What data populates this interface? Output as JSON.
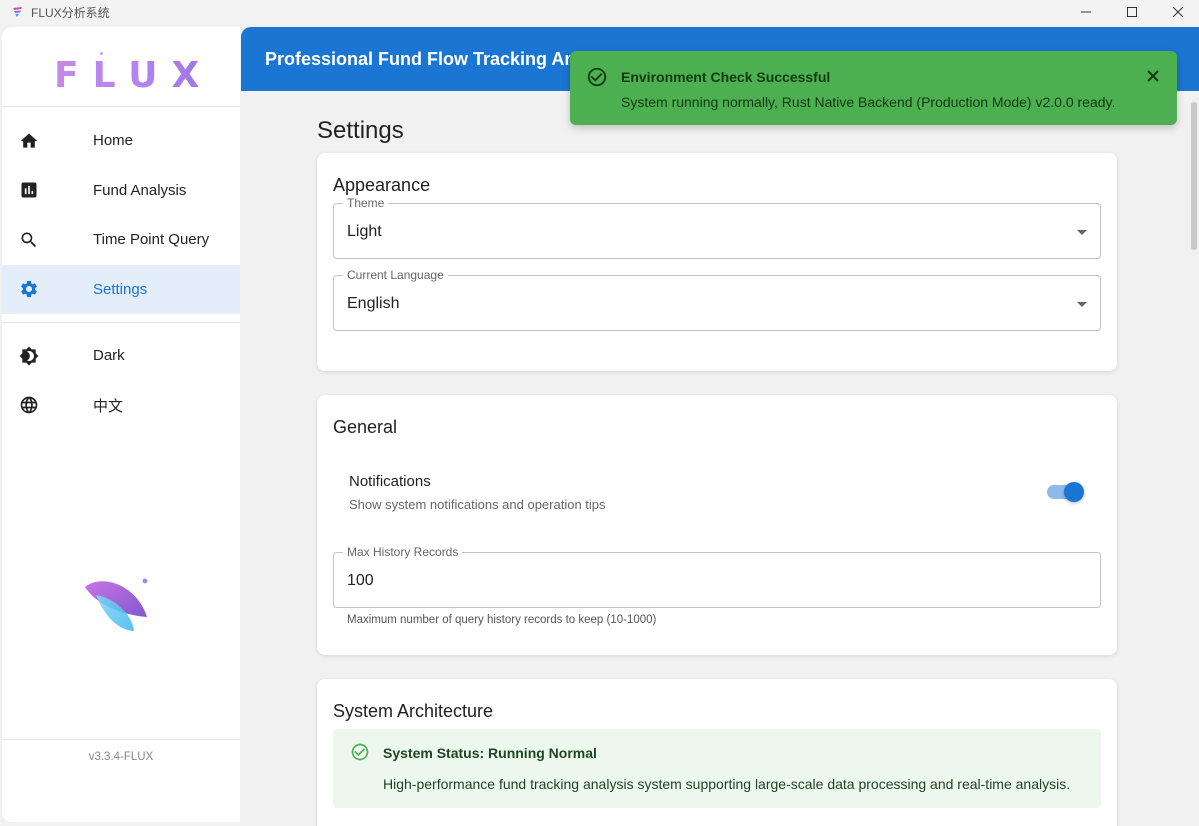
{
  "window": {
    "title": "FLUX分析系统"
  },
  "sidebar": {
    "logo": "FLUX",
    "nav": [
      {
        "label": "Home",
        "icon": "home-icon"
      },
      {
        "label": "Fund Analysis",
        "icon": "chart-icon"
      },
      {
        "label": "Time Point Query",
        "icon": "search-icon"
      },
      {
        "label": "Settings",
        "icon": "gear-icon",
        "active": true
      }
    ],
    "toggles": [
      {
        "label": "Dark",
        "icon": "brightness-icon"
      },
      {
        "label": "中文",
        "icon": "globe-icon"
      }
    ],
    "version": "v3.3.4-FLUX"
  },
  "header": {
    "title": "Professional Fund Flow Tracking Analysis"
  },
  "page": {
    "title": "Settings"
  },
  "appearance": {
    "title": "Appearance",
    "theme": {
      "label": "Theme",
      "value": "Light"
    },
    "language": {
      "label": "Current Language",
      "value": "English"
    }
  },
  "general": {
    "title": "General",
    "notifications": {
      "title": "Notifications",
      "desc": "Show system notifications and operation tips",
      "enabled": true
    },
    "history": {
      "label": "Max History Records",
      "value": "100",
      "helper": "Maximum number of query history records to keep (10-1000)"
    }
  },
  "architecture": {
    "title": "System Architecture",
    "status_title": "System Status: Running Normal",
    "status_desc": "High-performance fund tracking analysis system supporting large-scale data processing and real-time analysis."
  },
  "toast": {
    "title": "Environment Check Successful",
    "message": "System running normally, Rust Native Backend (Production Mode) v2.0.0 ready."
  },
  "colors": {
    "accent": "#1976d2",
    "header": "#1b75d3",
    "success": "#4caf50",
    "logo": "#b683f0"
  }
}
